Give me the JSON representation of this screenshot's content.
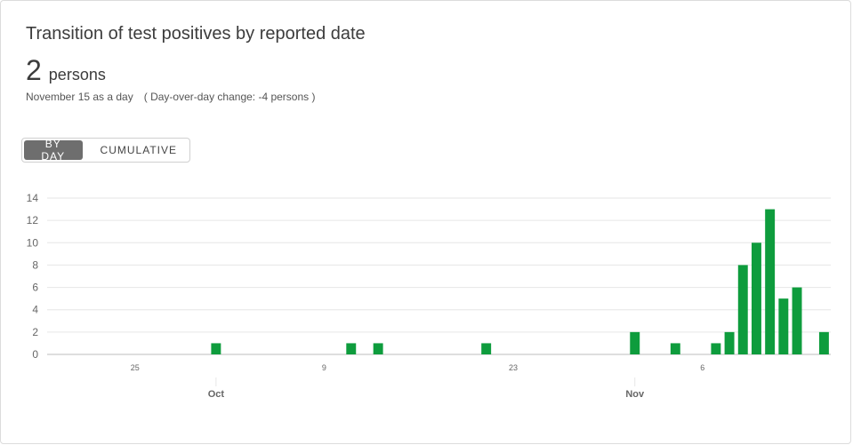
{
  "header": {
    "title": "Transition of test positives by reported date",
    "value": "2",
    "unit": "persons",
    "subline": "November 15 as a day　( Day-over-day change: -4 persons )"
  },
  "toggle": {
    "by_day_label": "BY DAY",
    "cumulative_label": "CUMULATIVE"
  },
  "colors": {
    "bar": "#0e9c3d",
    "grid": "#e6e6e6",
    "axis": "#bdbdbd",
    "active_toggle": "#6e6e6e"
  },
  "chart_data": {
    "type": "bar",
    "title": "Transition of test positives by reported date",
    "ylim": [
      0,
      14
    ],
    "yticks": [
      0,
      2,
      4,
      6,
      8,
      10,
      12,
      14
    ],
    "x_start": "2020-09-19",
    "x_end": "2020-11-15",
    "x_day_ticks": [
      {
        "date": "2020-09-25",
        "label": "25"
      },
      {
        "date": "2020-10-09",
        "label": "9"
      },
      {
        "date": "2020-10-23",
        "label": "23"
      },
      {
        "date": "2020-11-06",
        "label": "6"
      }
    ],
    "x_month_ticks": [
      {
        "date": "2020-10-01",
        "label": "Oct"
      },
      {
        "date": "2020-11-01",
        "label": "Nov"
      }
    ],
    "grid": true,
    "points": [
      {
        "date": "2020-10-01",
        "value": 1
      },
      {
        "date": "2020-10-11",
        "value": 1
      },
      {
        "date": "2020-10-13",
        "value": 1
      },
      {
        "date": "2020-10-21",
        "value": 1
      },
      {
        "date": "2020-11-01",
        "value": 2
      },
      {
        "date": "2020-11-04",
        "value": 1
      },
      {
        "date": "2020-11-07",
        "value": 1
      },
      {
        "date": "2020-11-08",
        "value": 2
      },
      {
        "date": "2020-11-09",
        "value": 8
      },
      {
        "date": "2020-11-10",
        "value": 10
      },
      {
        "date": "2020-11-11",
        "value": 13
      },
      {
        "date": "2020-11-12",
        "value": 5
      },
      {
        "date": "2020-11-13",
        "value": 6
      },
      {
        "date": "2020-11-15",
        "value": 2
      }
    ]
  }
}
